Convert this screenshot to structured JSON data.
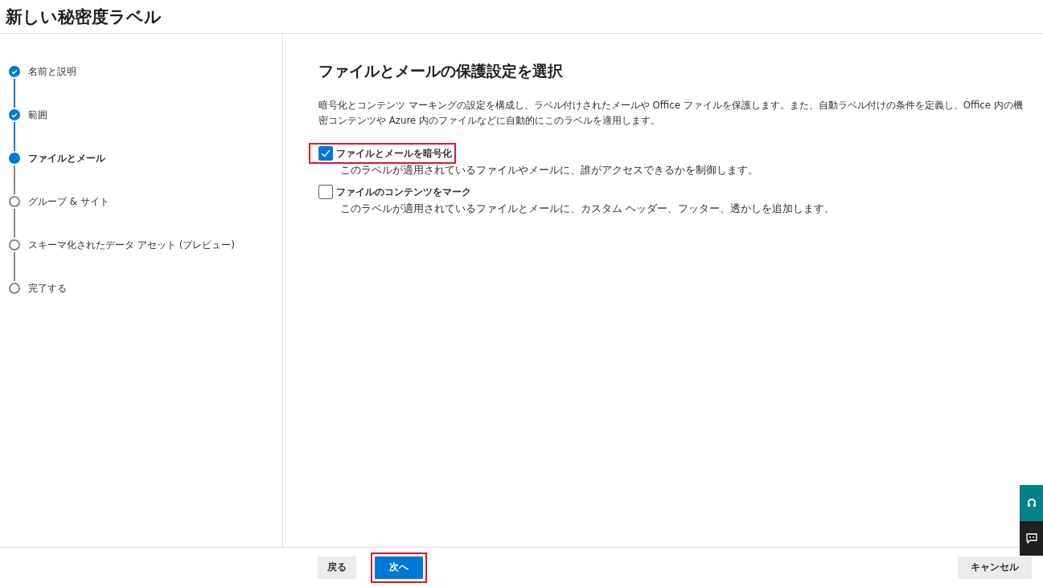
{
  "title": "新しい秘密度ラベル",
  "steps": [
    {
      "label": "名前と説明",
      "completed": true,
      "selected": false
    },
    {
      "label": "範囲",
      "completed": true,
      "selected": false
    },
    {
      "label": "ファイルとメール",
      "completed": false,
      "selected": true
    },
    {
      "label": "グループ & サイト",
      "completed": false,
      "selected": false
    },
    {
      "label": "スキーマ化されたデータ アセット (プレビュー)",
      "completed": false,
      "selected": false
    },
    {
      "label": "完了する",
      "completed": false,
      "selected": false
    }
  ],
  "heading": "ファイルとメールの保護設定を選択",
  "description": "暗号化とコンテンツ マーキングの設定を構成し、ラベル付けされたメールや Office ファイルを保護します。また、自動ラベル付けの条件を定義し、Office 内の機密コンテンツや Azure 内のファイルなどに自動的にこのラベルを適用します。",
  "options": [
    {
      "label": "ファイルとメールを暗号化",
      "description": "このラベルが適用されているファイルやメールに、誰がアクセスできるかを制御します。",
      "checked": true,
      "highlighted": true
    },
    {
      "label": "ファイルのコンテンツをマーク",
      "description": "このラベルが適用されているファイルとメールに、カスタム ヘッダー、フッター、透かしを追加します。",
      "checked": false,
      "highlighted": false
    }
  ],
  "buttons": [
    {
      "label": "戻る",
      "kind": "secondary",
      "highlighted": false
    },
    {
      "label": "次へ",
      "kind": "primary",
      "highlighted": true
    }
  ],
  "cancel": {
    "label": "キャンセル"
  }
}
